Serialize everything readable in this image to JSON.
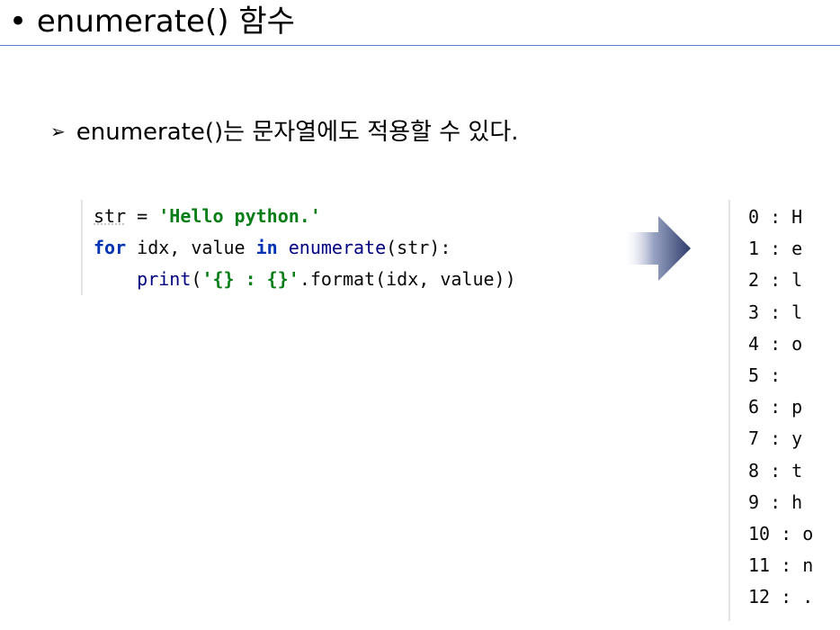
{
  "slide": {
    "title": "• enumerate() 함수",
    "bullet_marker": "➢",
    "bullet_text": "enumerate()는 문자열에도 적용할 수 있다."
  },
  "code": {
    "line1": {
      "var": "str",
      "op": " = ",
      "value": "'Hello python.'"
    },
    "line2": {
      "kw_for": "for",
      "mid": " idx, value ",
      "kw_in": "in",
      "fn": " enumerate",
      "tail": "(str):"
    },
    "line3": {
      "indent": "    ",
      "fn": "print",
      "open": "(",
      "fmt": "'{} : {}'",
      "tail": ".format(idx, value))"
    }
  },
  "output": {
    "lines": [
      "0 : H",
      "1 : e",
      "2 : l",
      "3 : l",
      "4 : o",
      "5 : ",
      "6 : p",
      "7 : y",
      "8 : t",
      "9 : h",
      "10 : o",
      "11 : n",
      "12 : ."
    ]
  },
  "colors": {
    "keyword": "#0033b3",
    "string": "#067d17",
    "function": "#000080",
    "title_rule": "#5b7bd1",
    "arrow": "#2f3c6b"
  }
}
